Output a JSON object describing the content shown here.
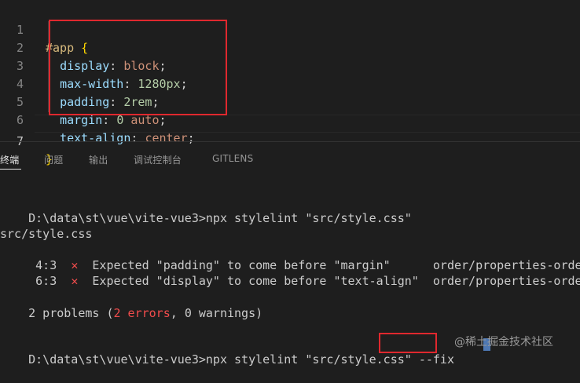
{
  "editor": {
    "lines": [
      {
        "number": "1",
        "selector": "#app",
        "brace": "{"
      },
      {
        "number": "2",
        "property": "display",
        "value": "block"
      },
      {
        "number": "3",
        "property": "max-width",
        "value": "1280px"
      },
      {
        "number": "4",
        "property": "padding",
        "value": "2rem"
      },
      {
        "number": "5",
        "property": "margin",
        "value_num": "0",
        "value": "auto"
      },
      {
        "number": "6",
        "property": "text-align",
        "value": "center"
      },
      {
        "number": "7",
        "brace": "}"
      }
    ]
  },
  "panel": {
    "tabs": [
      {
        "label": "终端",
        "active": true
      },
      {
        "label": "问题",
        "active": false
      },
      {
        "label": "输出",
        "active": false
      },
      {
        "label": "调试控制台",
        "active": false
      },
      {
        "label": "GITLENS",
        "active": false
      }
    ]
  },
  "terminal": {
    "cmd1_prompt": "D:\\data\\st\\vue\\vite-vue3>",
    "cmd1_command": "npx stylelint \"src/style.css\"",
    "file": "src/style.css",
    "problems": [
      {
        "location": " 4:3",
        "icon": "✕",
        "message": "Expected \"padding\" to come before \"margin\"     ",
        "rule": "order/properties-order"
      },
      {
        "location": " 6:3",
        "icon": "✕",
        "message": "Expected \"display\" to come before \"text-align\" ",
        "rule": "order/properties-order"
      }
    ],
    "summary": {
      "prefix": "2 problems (",
      "errors": "2 errors",
      "sep": ", ",
      "warnings": "0 warnings",
      "suffix": ")"
    },
    "cmd2_prompt": "D:\\data\\st\\vue\\vite-vue3>",
    "cmd2_command": "npx stylelint \"src/style.css\" ",
    "cmd2_flag": "--fix"
  },
  "watermark": "@稀土掘金技术社区",
  "colors": {
    "background": "#1e1e1e",
    "highlight_box": "#e0282e",
    "error": "#f14c4c"
  }
}
